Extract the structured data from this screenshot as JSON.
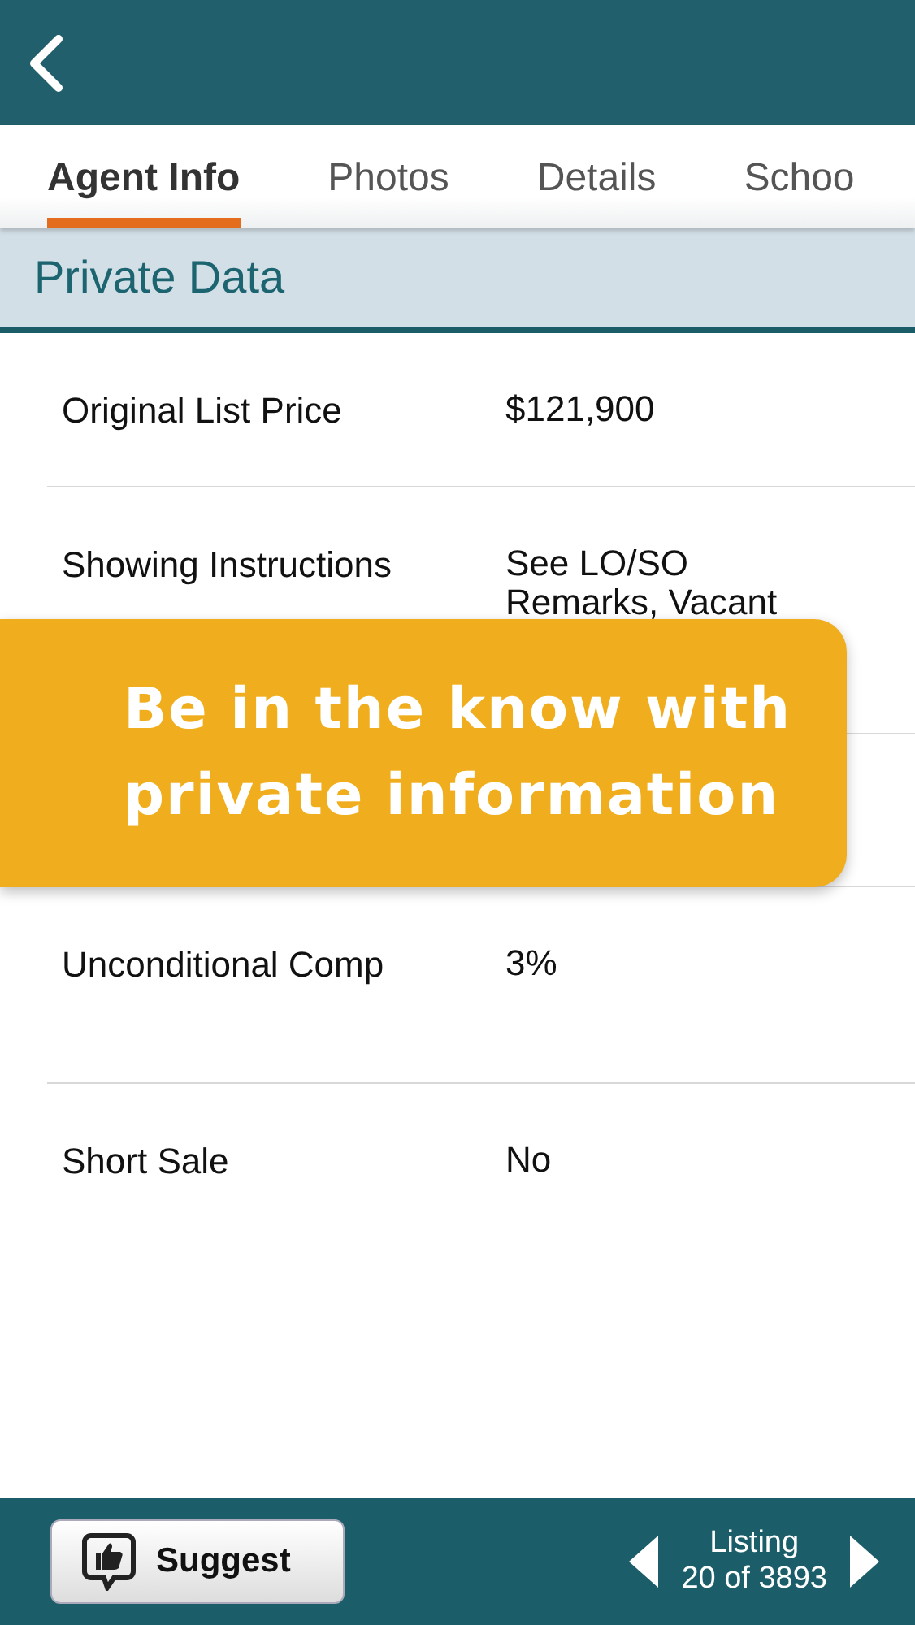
{
  "tabs": [
    {
      "label": "Agent Info",
      "selected": true
    },
    {
      "label": "Photos",
      "selected": false
    },
    {
      "label": "Details",
      "selected": false
    },
    {
      "label": "Schoo",
      "selected": false
    }
  ],
  "section": {
    "title": "Private Data"
  },
  "rows": [
    {
      "label": "Original List Price",
      "value": "$121,900"
    },
    {
      "label": "Showing Instructions",
      "value": "See LO/SO Remarks, Vacant"
    },
    {
      "label": "Unconditional Comp",
      "value": "3%"
    },
    {
      "label": "Short Sale",
      "value": "No"
    }
  ],
  "banner": {
    "text": "Be in the know with private information"
  },
  "footer": {
    "button": "Suggest",
    "listing_label": "Listing",
    "listing_position": "20 of 3893"
  }
}
